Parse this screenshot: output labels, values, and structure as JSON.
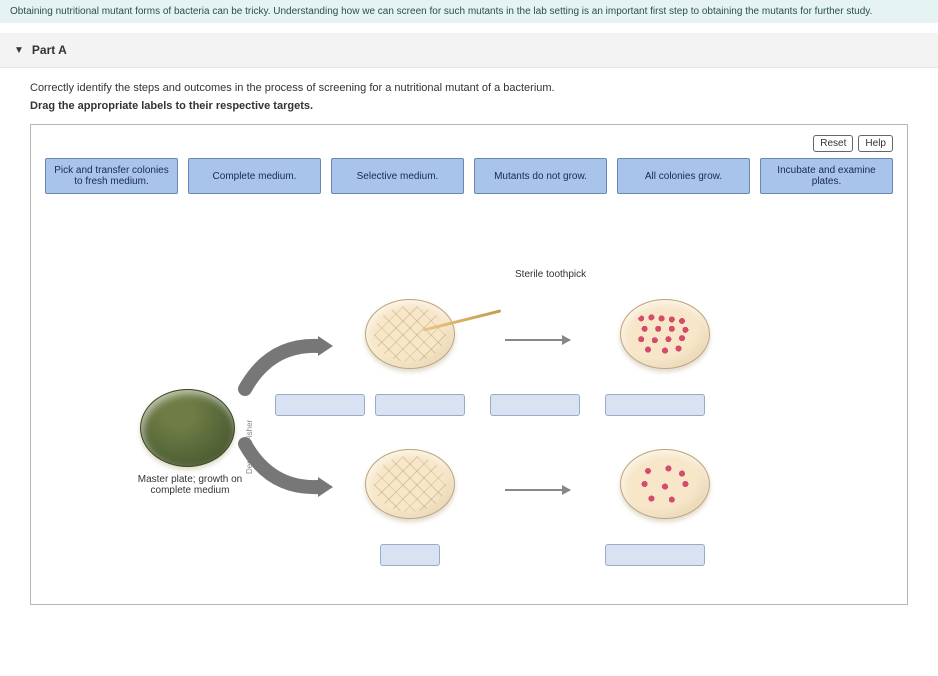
{
  "info": "Obtaining nutritional mutant forms of bacteria can be tricky. Understanding how we can screen for such mutants in the lab setting is an important first step to obtaining the mutants for further study.",
  "part": {
    "label": "Part A"
  },
  "prompt": "Correctly identify the steps and outcomes in the process of screening for a nutritional mutant of a bacterium.",
  "instruction": "Drag the appropriate labels to their respective targets.",
  "controls": {
    "reset": "Reset",
    "help": "Help"
  },
  "labels": {
    "pick": "Pick and transfer colonies to fresh medium.",
    "complete": "Complete medium.",
    "selective": "Selective medium.",
    "mutants": "Mutants do not grow.",
    "all": "All colonies grow.",
    "incubate": "Incubate and examine plates."
  },
  "diagram": {
    "sterile": "Sterile toothpick",
    "master": "Master plate; growth on complete medium",
    "credit": "Derek J. Fisher"
  }
}
